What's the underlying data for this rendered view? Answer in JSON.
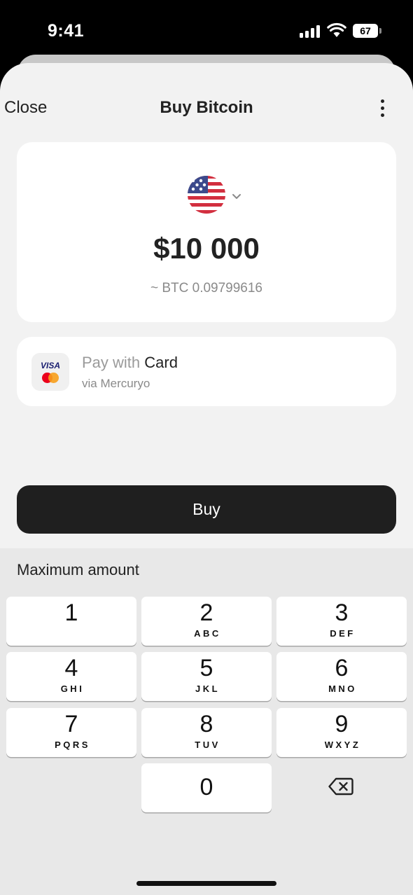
{
  "status_bar": {
    "time": "9:41",
    "battery": "67"
  },
  "nav": {
    "close_label": "Close",
    "title": "Buy Bitcoin"
  },
  "amount": {
    "value": "$10 000",
    "btc": "~ BTC 0.09799616"
  },
  "payment": {
    "prefix": "Pay with ",
    "method": "Card",
    "provider": "via Mercuryo",
    "visa_text": "VISA"
  },
  "buy_label": "Buy",
  "keypad": {
    "hint": "Maximum amount",
    "keys": [
      {
        "num": "1",
        "letters": ""
      },
      {
        "num": "2",
        "letters": "ABC"
      },
      {
        "num": "3",
        "letters": "DEF"
      },
      {
        "num": "4",
        "letters": "GHI"
      },
      {
        "num": "5",
        "letters": "JKL"
      },
      {
        "num": "6",
        "letters": "MNO"
      },
      {
        "num": "7",
        "letters": "PQRS"
      },
      {
        "num": "8",
        "letters": "TUV"
      },
      {
        "num": "9",
        "letters": "WXYZ"
      },
      {
        "num": "0",
        "letters": ""
      }
    ]
  },
  "colors": {
    "sheet_bg": "#f2f2f2",
    "button_bg": "#1f1f1f",
    "keypad_bg": "#e8e8e8"
  }
}
